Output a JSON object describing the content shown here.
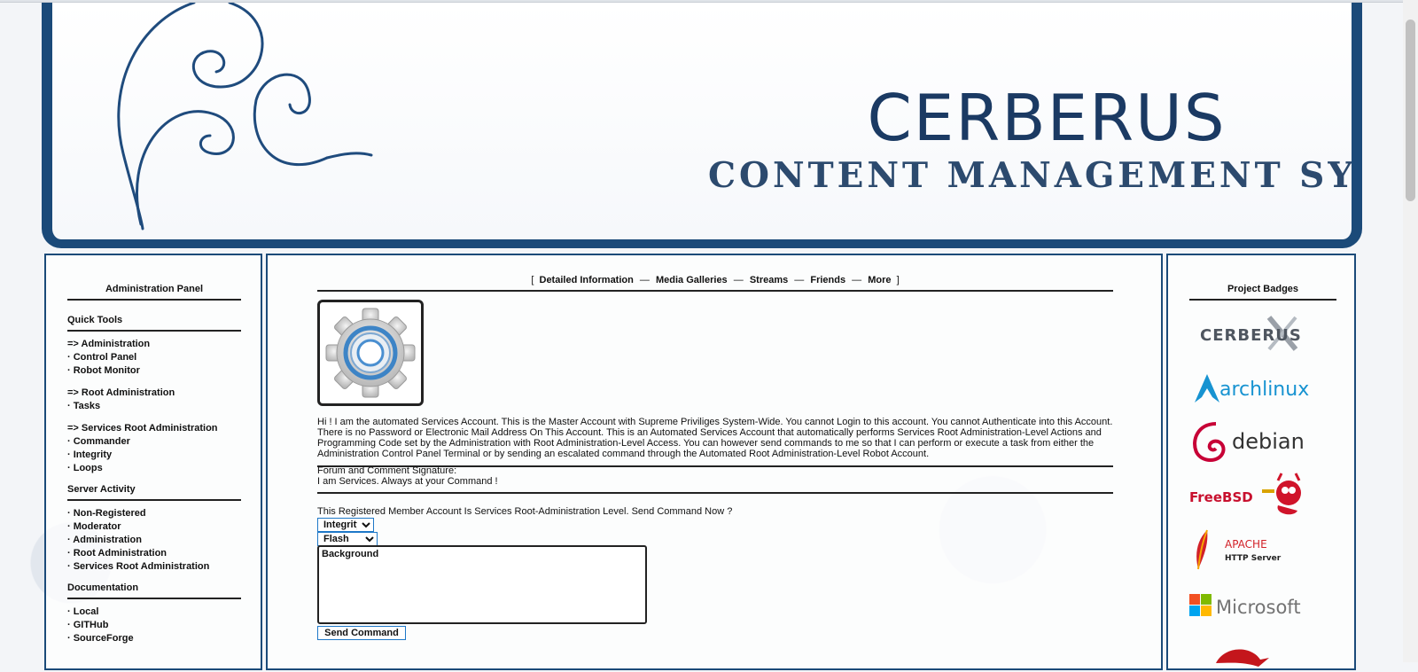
{
  "banner": {
    "title": "CERBERUS",
    "subtitle": "CONTENT MANAGEMENT SYSTEM"
  },
  "left": {
    "heading": "Administration Panel",
    "sections": [
      {
        "title": "Quick Tools",
        "items": [
          "=> Administration",
          "· Control Panel",
          "· Robot Monitor",
          "=> Root Administration",
          "· Tasks",
          "=> Services Root Administration",
          "· Commander",
          "· Integrity",
          "· Loops"
        ]
      },
      {
        "title": "Server Activity",
        "items": [
          "· Non-Registered",
          "· Moderator",
          "· Administration",
          "· Root Administration",
          "· Services Root Administration"
        ]
      },
      {
        "title": "Documentation",
        "items": [
          "· Local",
          "· GITHub",
          "· SourceForge"
        ]
      }
    ]
  },
  "center": {
    "tabs": {
      "open": "[",
      "close": "]",
      "separator": "—",
      "items": [
        "Detailed Information",
        "Media Galleries",
        "Streams",
        "Friends",
        "More"
      ]
    },
    "bio": "Hi ! I am the automated Services Account. This is the Master Account with Supreme Priviliges System-Wide. You cannot Login to this account. You cannot Authenticate into this Account. There is no Password or Electronic Mail Address On This Account. This is an Automated Services Account that automatically performs Services Root Administration-Level Actions and Programming Code set by the Administration with Root Administration-Level Access. You can however send commands to me so that I can perform or execute a task from either the Administration Control Panel Terminal or by sending an escalated command through the Automated Root Administration-Level Robot Account.",
    "signature_label": "Forum and Comment Signature:",
    "signature_text": "I am Services. Always at your Command !",
    "command_prompt": "This Registered Member Account Is Services Root-Administration Level. Send Command Now ?",
    "select_1": "Integrity",
    "select_2": "Flash",
    "textarea_value": "Background",
    "send_label": "Send Command"
  },
  "right": {
    "heading": "Project Badges",
    "badges": {
      "cerberus": "CERBERUS",
      "arch": "archlinux",
      "debian": "debian",
      "freebsd": "FreeBSD",
      "apache_1": "APACHE",
      "apache_2": "HTTP Server",
      "microsoft": "Microsoft"
    }
  },
  "colors": {
    "frame": "#1b4a79",
    "title": "#1b3a63",
    "focus": "#1e78c8"
  }
}
